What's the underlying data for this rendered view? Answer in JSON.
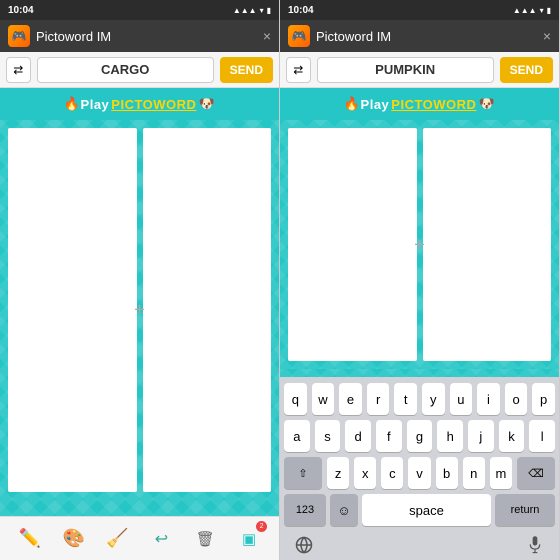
{
  "panels": [
    {
      "id": "left",
      "statusBar": {
        "time": "10:04",
        "icons": [
          "signal",
          "wifi",
          "battery"
        ]
      },
      "titleBar": {
        "appIcon": "🎮",
        "title": "Pictoword IM",
        "closeLabel": "×"
      },
      "inputBar": {
        "shuffleLabel": "⇄",
        "wordValue": "CARGO",
        "sendLabel": "SEND"
      },
      "playBanner": {
        "fireEmoji": "🔥",
        "playLabel": " Play ",
        "pictowordLabel": "PICTOWORD",
        "dogEmoji": "🐶"
      },
      "plusLabel": "+",
      "toolbar": {
        "pencilLabel": "✏️",
        "paletteLabel": "🎨",
        "eraserLabel": "🧹",
        "undoLabel": "↩",
        "trashLabel": "🗑",
        "layersLabel": "▣",
        "layersBadge": "2"
      },
      "hasKeyboard": false
    },
    {
      "id": "right",
      "statusBar": {
        "time": "10:04",
        "icons": [
          "signal",
          "wifi",
          "battery"
        ]
      },
      "titleBar": {
        "appIcon": "🎮",
        "title": "Pictoword IM",
        "closeLabel": "×"
      },
      "inputBar": {
        "shuffleLabel": "⇄",
        "wordValue": "PUMPKIN",
        "sendLabel": "SEND"
      },
      "playBanner": {
        "fireEmoji": "🔥",
        "playLabel": " Play ",
        "pictowordLabel": "PICTOWORD",
        "dogEmoji": "🐶"
      },
      "plusLabel": "+",
      "keyboard": {
        "row1": [
          "q",
          "w",
          "e",
          "r",
          "t",
          "y",
          "u",
          "i",
          "o",
          "p"
        ],
        "row2": [
          "a",
          "s",
          "d",
          "f",
          "g",
          "h",
          "j",
          "k",
          "l"
        ],
        "row3": [
          "z",
          "x",
          "c",
          "v",
          "b",
          "n",
          "m"
        ],
        "shiftLabel": "⇧",
        "deleteLabel": "⌫",
        "numbersLabel": "123",
        "emojiLabel": "☺",
        "spaceLabel": "space",
        "returnLabel": "return"
      },
      "hasKeyboard": true
    }
  ]
}
